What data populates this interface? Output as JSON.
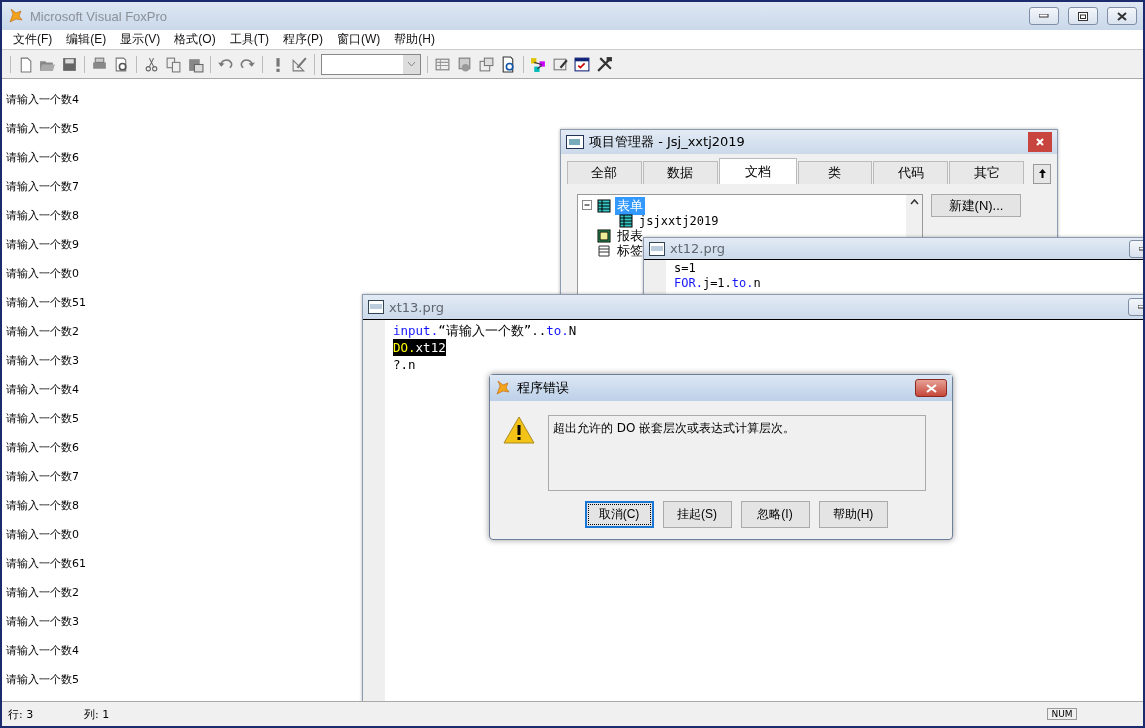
{
  "window": {
    "title": "Microsoft Visual FoxPro"
  },
  "menu": [
    "文件(F)",
    "编辑(E)",
    "显示(V)",
    "格式(O)",
    "工具(T)",
    "程序(P)",
    "窗口(W)",
    "帮助(H)"
  ],
  "output_lines": [
    "请输入一个数4",
    "请输入一个数5",
    "请输入一个数6",
    "请输入一个数7",
    "请输入一个数8",
    "请输入一个数9",
    "请输入一个数0",
    "请输入一个数51",
    "请输入一个数2",
    "请输入一个数3",
    "请输入一个数4",
    "请输入一个数5",
    "请输入一个数6",
    "请输入一个数7",
    "请输入一个数8",
    "请输入一个数0",
    "请输入一个数61",
    "请输入一个数2",
    "请输入一个数3",
    "请输入一个数4",
    "请输入一个数5"
  ],
  "project_manager": {
    "title": "项目管理器 - Jsj_xxtj2019",
    "tabs": [
      {
        "label": "全部",
        "selected": false
      },
      {
        "label": "数据",
        "selected": false
      },
      {
        "label": "文档",
        "selected": true
      },
      {
        "label": "类",
        "selected": false
      },
      {
        "label": "代码",
        "selected": false
      },
      {
        "label": "其它",
        "selected": false
      }
    ],
    "tree": [
      {
        "label": "表单",
        "kind": "form",
        "selected": true,
        "expanded": true,
        "children": [
          {
            "label": "jsjxxtj2019",
            "kind": "form",
            "selected": false
          }
        ]
      },
      {
        "label": "报表",
        "kind": "report",
        "selected": false
      },
      {
        "label": "标签",
        "kind": "label",
        "selected": false
      }
    ],
    "buttons": [
      "新建(N)..."
    ]
  },
  "editors": [
    {
      "title": "xt12.prg",
      "lines": [
        {
          "selected": false,
          "tokens": [
            {
              "text": "s=1",
              "kind": "plain"
            }
          ]
        },
        {
          "selected": false,
          "tokens": [
            {
              "text": "FOR.",
              "kind": "keyword"
            },
            {
              "text": "j=1.",
              "kind": "plain"
            },
            {
              "text": "to.",
              "kind": "keyword"
            },
            {
              "text": "n",
              "kind": "plain"
            }
          ]
        }
      ]
    },
    {
      "title": "xt13.prg",
      "lines": [
        {
          "selected": false,
          "tokens": [
            {
              "text": "input.",
              "kind": "keyword"
            },
            {
              "text": "“请输入一个数”..",
              "kind": "plain"
            },
            {
              "text": "to.",
              "kind": "keyword"
            },
            {
              "text": "N",
              "kind": "plain"
            }
          ]
        },
        {
          "selected": true,
          "tokens": [
            {
              "text": "DO.",
              "kind": "keyword"
            },
            {
              "text": "xt12",
              "kind": "plain"
            }
          ]
        },
        {
          "selected": false,
          "tokens": [
            {
              "text": "?.n",
              "kind": "plain"
            }
          ]
        }
      ]
    }
  ],
  "dialog": {
    "title": "程序错误",
    "message": "超出允许的 DO 嵌套层次或表达式计算层次。",
    "buttons": [
      {
        "label": "取消(C)",
        "selected": true
      },
      {
        "label": "挂起(S)",
        "selected": false
      },
      {
        "label": "忽略(I)",
        "selected": false
      },
      {
        "label": "帮助(H)",
        "selected": false
      }
    ]
  },
  "status_bar": {
    "row": "行: 3",
    "column": "列: 1",
    "num": "NUM"
  }
}
